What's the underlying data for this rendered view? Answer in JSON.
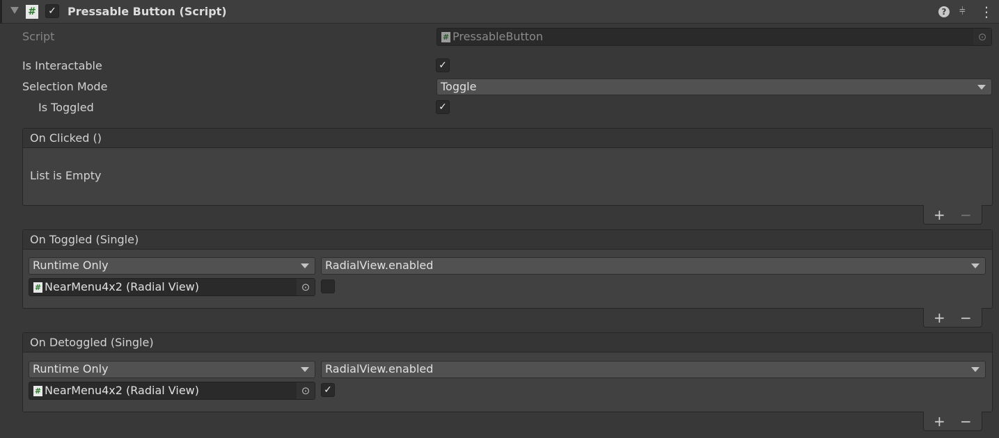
{
  "component": {
    "title": "Pressable Button (Script)",
    "enabled": true,
    "icons": [
      "help-icon",
      "presets-icon",
      "more-icon"
    ]
  },
  "fields": {
    "script_label": "Script",
    "script_value": "PressableButton",
    "interactable_label": "Is Interactable",
    "interactable": true,
    "selection_label": "Selection Mode",
    "selection_value": "Toggle",
    "toggled_label": "Is Toggled",
    "toggled": true
  },
  "events": [
    {
      "title": "On Clicked ()",
      "empty_text": "List is Empty"
    },
    {
      "title": "On Toggled (Single)",
      "mode": "Runtime Only",
      "function": "RadialView.enabled",
      "target": "NearMenu4x2 (Radial View)",
      "value": false
    },
    {
      "title": "On Detoggled (Single)",
      "mode": "Runtime Only",
      "function": "RadialView.enabled",
      "target": "NearMenu4x2 (Radial View)",
      "value": true
    }
  ],
  "list_buttons": {
    "add": "+",
    "remove": "−"
  },
  "glyphs": {
    "check": "✓",
    "hash": "#",
    "target": "⊙",
    "help": "?",
    "more": "⋮"
  }
}
